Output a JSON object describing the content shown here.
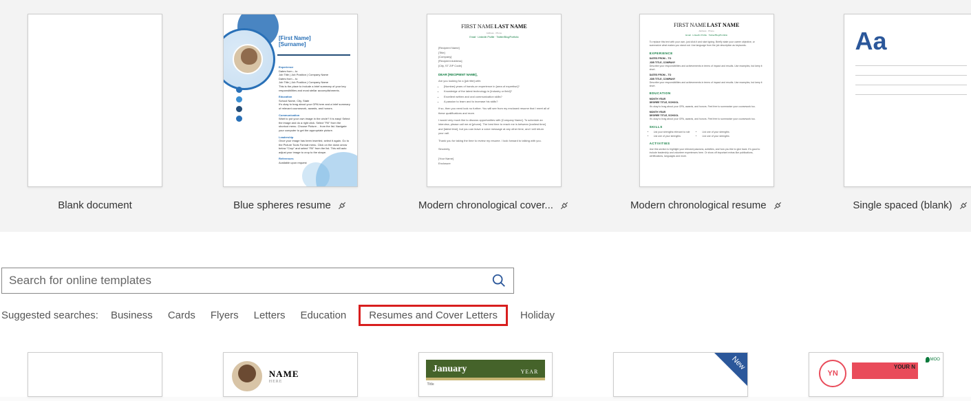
{
  "templates": [
    {
      "label": "Blank document",
      "pinnable": false
    },
    {
      "label": "Blue spheres resume",
      "pinnable": true
    },
    {
      "label": "Modern chronological cover...",
      "pinnable": true
    },
    {
      "label": "Modern chronological resume",
      "pinnable": true
    },
    {
      "label": "Single spaced (blank)",
      "pinnable": true
    }
  ],
  "spheres": {
    "firstname": "[First Name]",
    "surname": "[Surname]",
    "sections": {
      "exp": "Experience",
      "edu": "Education",
      "comm": "Communication",
      "lead": "Leadership",
      "ref": "References"
    }
  },
  "cover": {
    "first": "FIRST NAME",
    "last": "LAST NAME",
    "sub": "Email · LinkedIn Profile · Twitter/Blog/Portfolio",
    "dear": "DEAR [RECIPIENT NAME],"
  },
  "resume": {
    "first": "FIRST NAME",
    "last": "LAST NAME",
    "sub": "Email · LinkedIn Profile · Twitter/Blog/Portfolio",
    "sections": {
      "exp": "EXPERIENCE",
      "edu": "EDUCATION",
      "skills": "SKILLS",
      "act": "ACTIVITIES"
    },
    "job": "JOB TITLE, COMPANY",
    "degree": "DEGREE TITLE, SCHOOL",
    "dates": "DATES FROM – TO",
    "month": "MONTH YEAR"
  },
  "single": {
    "aa": "Aa"
  },
  "search": {
    "placeholder": "Search for online templates"
  },
  "suggested": {
    "label": "Suggested searches:",
    "items": [
      "Business",
      "Cards",
      "Flyers",
      "Letters",
      "Education",
      "Resumes and Cover Letters",
      "Holiday"
    ]
  },
  "lower": {
    "photo": {
      "name": "NAME",
      "here": "HERE"
    },
    "calendar": {
      "month": "January",
      "year": "YEAR"
    },
    "new_badge": "New",
    "moo": {
      "initials": "YN",
      "name": "YOUR N",
      "logo": "MOO"
    }
  }
}
